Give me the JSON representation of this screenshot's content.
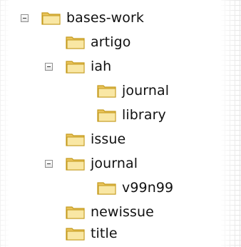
{
  "tree": {
    "nodes": [
      {
        "label": "bases-work",
        "depth": 0,
        "expanded": true,
        "icon": "folder-icon"
      },
      {
        "label": "artigo",
        "depth": 1,
        "expanded": false,
        "icon": "folder-icon"
      },
      {
        "label": "iah",
        "depth": 1,
        "expanded": true,
        "icon": "folder-icon"
      },
      {
        "label": "journal",
        "depth": 2,
        "expanded": false,
        "icon": "folder-icon"
      },
      {
        "label": "library",
        "depth": 2,
        "expanded": false,
        "icon": "folder-icon"
      },
      {
        "label": "issue",
        "depth": 1,
        "expanded": false,
        "icon": "folder-icon"
      },
      {
        "label": "journal",
        "depth": 1,
        "expanded": true,
        "icon": "folder-icon"
      },
      {
        "label": "v99n99",
        "depth": 2,
        "expanded": false,
        "icon": "folder-icon"
      },
      {
        "label": "newissue",
        "depth": 1,
        "expanded": false,
        "icon": "folder-icon"
      },
      {
        "label": "title",
        "depth": 1,
        "expanded": false,
        "icon": "folder-icon"
      }
    ]
  },
  "colors": {
    "folder_fill": "#f4d67a",
    "folder_outline": "#c49a1c",
    "toggle_border": "#8f8f8f"
  }
}
